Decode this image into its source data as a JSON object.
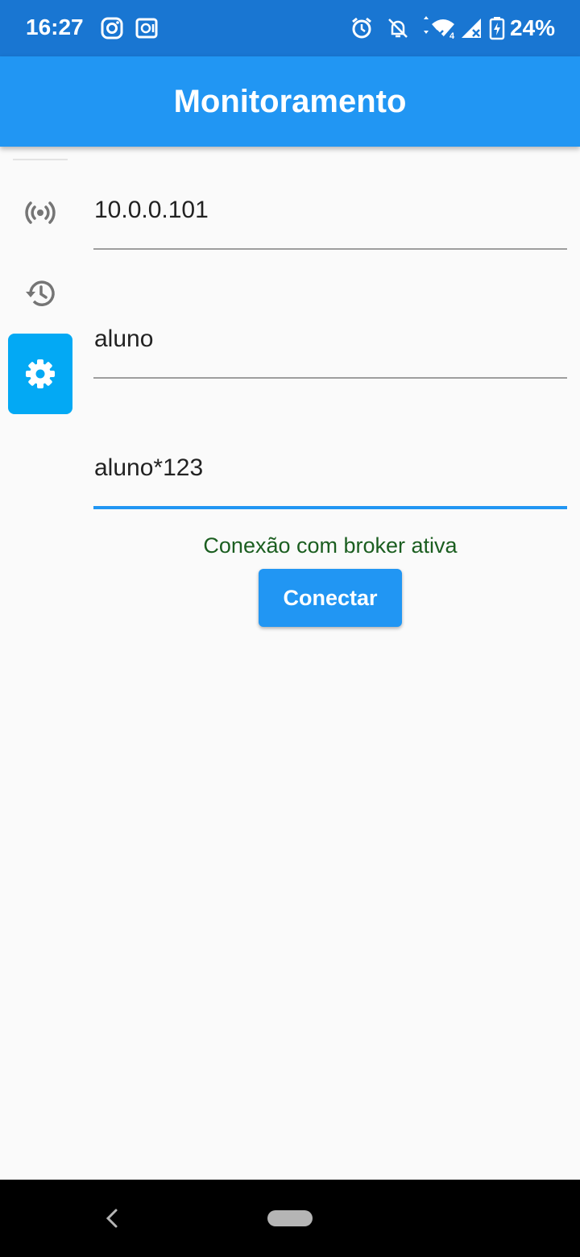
{
  "status_bar": {
    "time": "16:27",
    "battery_percent": "24%",
    "icons": [
      "instagram-icon",
      "camera-app-icon",
      "alarm-icon",
      "notifications-off-icon",
      "data-arrows-icon",
      "wifi-icon",
      "cell-signal-icon",
      "battery-charging-icon"
    ]
  },
  "app_bar": {
    "title": "Monitoramento"
  },
  "nav_rail": {
    "items": [
      {
        "icon": "broadcast-icon",
        "active": false
      },
      {
        "icon": "history-icon",
        "active": false
      },
      {
        "icon": "settings-icon",
        "active": true
      }
    ],
    "active_color": "#03a9f4"
  },
  "form": {
    "host_value": "10.0.0.101",
    "user_value": "aluno",
    "password_value": "aluno*123",
    "focused_field": "password"
  },
  "connection": {
    "status_text": "Conexão com broker ativa",
    "status_color": "#1b5e20",
    "connect_label": "Conectar"
  },
  "colors": {
    "status_bar": "#1976d2",
    "primary": "#2196f3",
    "background": "#fafafa"
  }
}
